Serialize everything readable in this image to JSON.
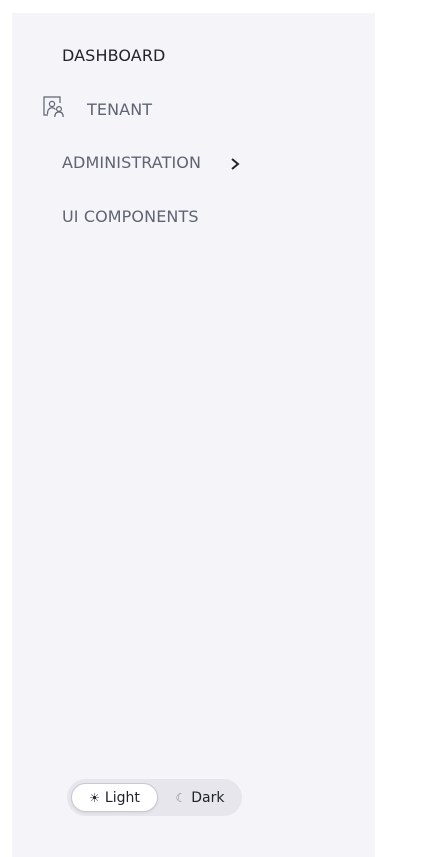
{
  "nav": {
    "items": [
      {
        "label": "DASHBOARD",
        "icon": "",
        "active": true
      },
      {
        "label": "TENANT",
        "icon": "users-icon",
        "active": false
      },
      {
        "label": "ADMINISTRATION",
        "icon": "chevron-right-icon",
        "active": false
      },
      {
        "label": "UI COMPONENTS",
        "icon": "",
        "active": false
      }
    ]
  },
  "theme_toggle": {
    "light_label": "Light",
    "light_icon": "☀",
    "dark_label": "Dark",
    "dark_icon": "☾",
    "selected": "Light"
  },
  "colors": {
    "sidebar_bg": "#f4f4f9",
    "text_active": "#22242b",
    "text_muted": "#5f6472",
    "toggle_bg": "#e6e6ec"
  }
}
